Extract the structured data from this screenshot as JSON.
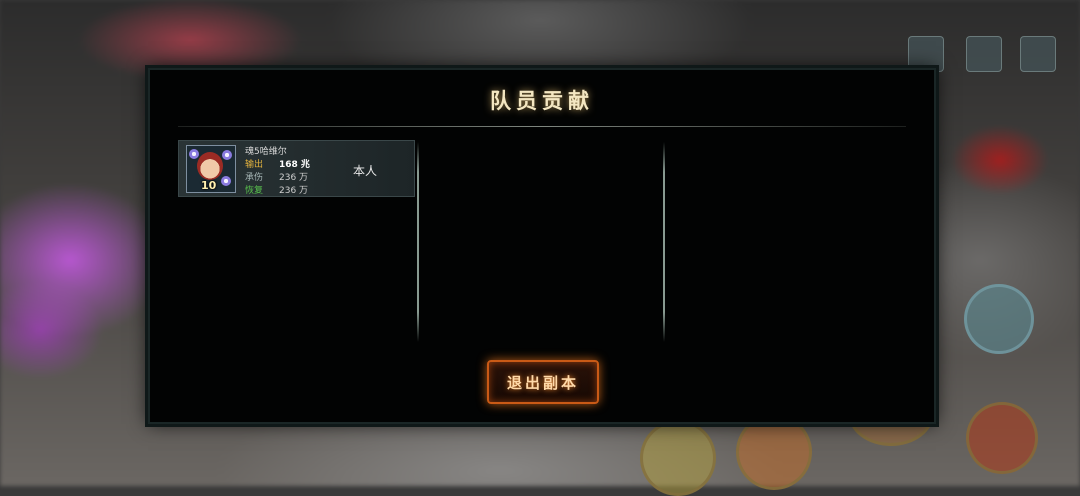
{
  "dialog": {
    "title": "队员贡献",
    "exit_button": "退出副本"
  },
  "members": [
    {
      "name": "魂5哈维尔",
      "level": "10",
      "tag": "本人",
      "stats": [
        {
          "label": "输出",
          "value": "168 兆"
        },
        {
          "label": "承伤",
          "value": "236 万"
        },
        {
          "label": "恢复",
          "value": "236 万"
        }
      ]
    }
  ],
  "colors": {
    "title_glow": "#e6be6e",
    "output_label": "#e3b33e",
    "heal_label": "#59c24d",
    "exit_border": "#c95a16"
  }
}
